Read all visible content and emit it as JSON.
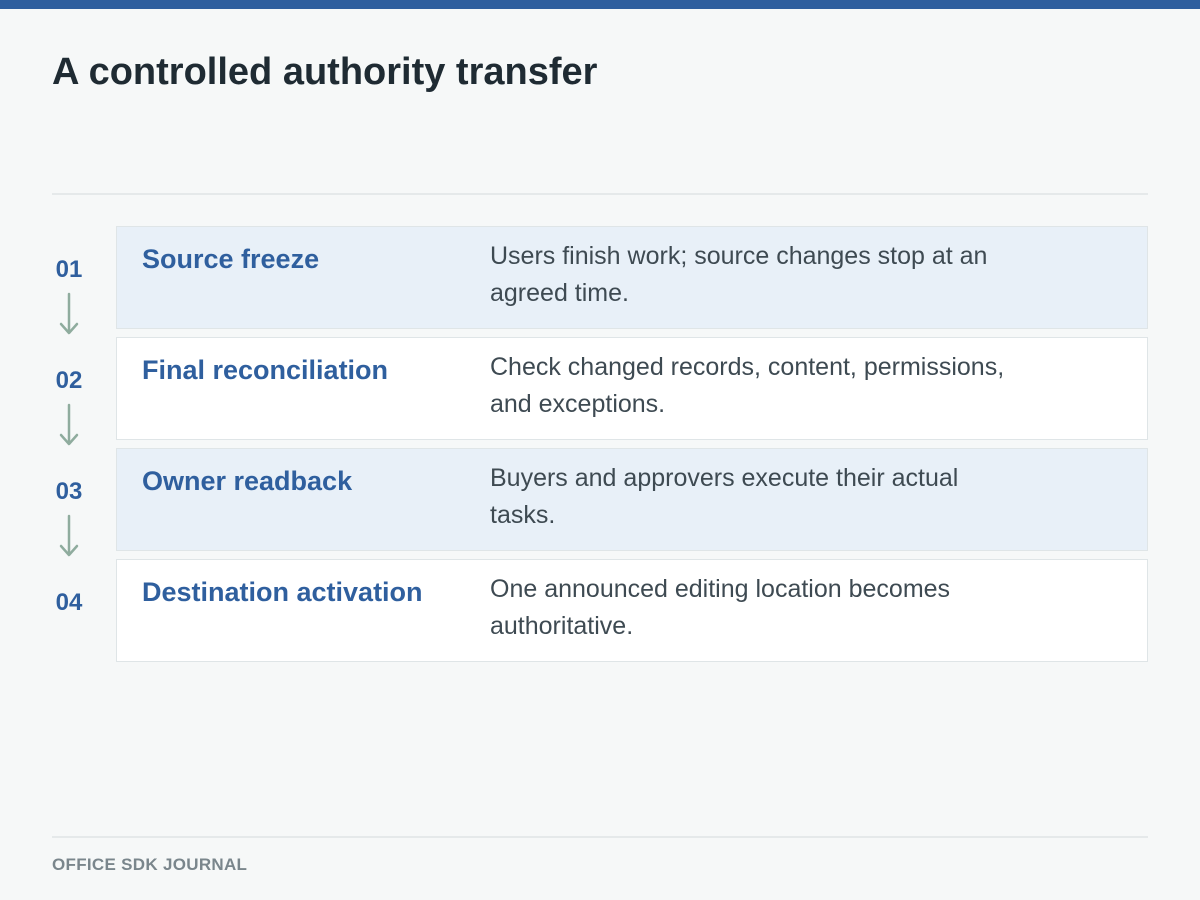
{
  "title": "A controlled authority transfer",
  "accent_color": "#2f5f9e",
  "arrow_color": "#8fac9e",
  "shaded_card_color": "#e8f0f8",
  "steps": [
    {
      "number": "01",
      "title": "Source freeze",
      "description": "Users finish work; source changes stop at an agreed time."
    },
    {
      "number": "02",
      "title": "Final reconciliation",
      "description": "Check changed records, content, permissions, and exceptions."
    },
    {
      "number": "03",
      "title": "Owner readback",
      "description": "Buyers and approvers execute their actual tasks."
    },
    {
      "number": "04",
      "title": "Destination activation",
      "description": "One announced editing location becomes authoritative."
    }
  ],
  "footer": "OFFICE SDK JOURNAL"
}
